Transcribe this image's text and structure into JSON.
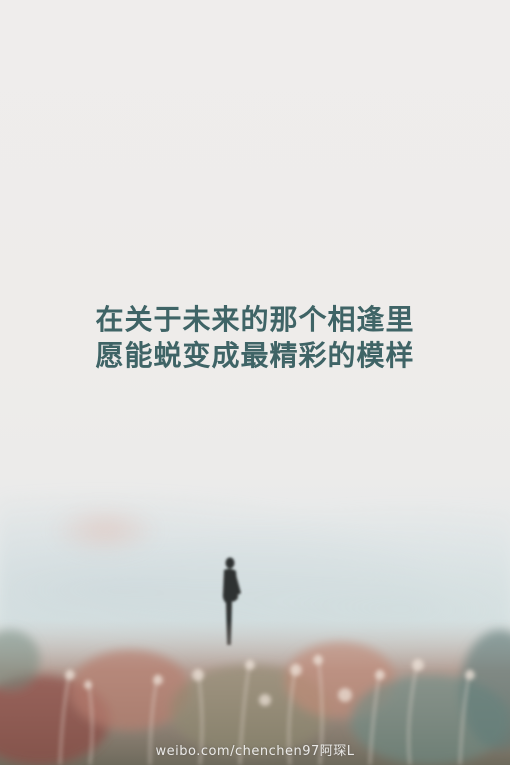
{
  "quote": {
    "line1": "在关于未来的那个相逢里",
    "line2": "愿能蜕变成最精彩的模样"
  },
  "watermark": "weibo.com/chenchen97阿琛L",
  "colors": {
    "text": "#3f6466",
    "sky": "#eeecea",
    "grass_warm": "#b9786a",
    "grass_cool": "#6f8f86"
  }
}
